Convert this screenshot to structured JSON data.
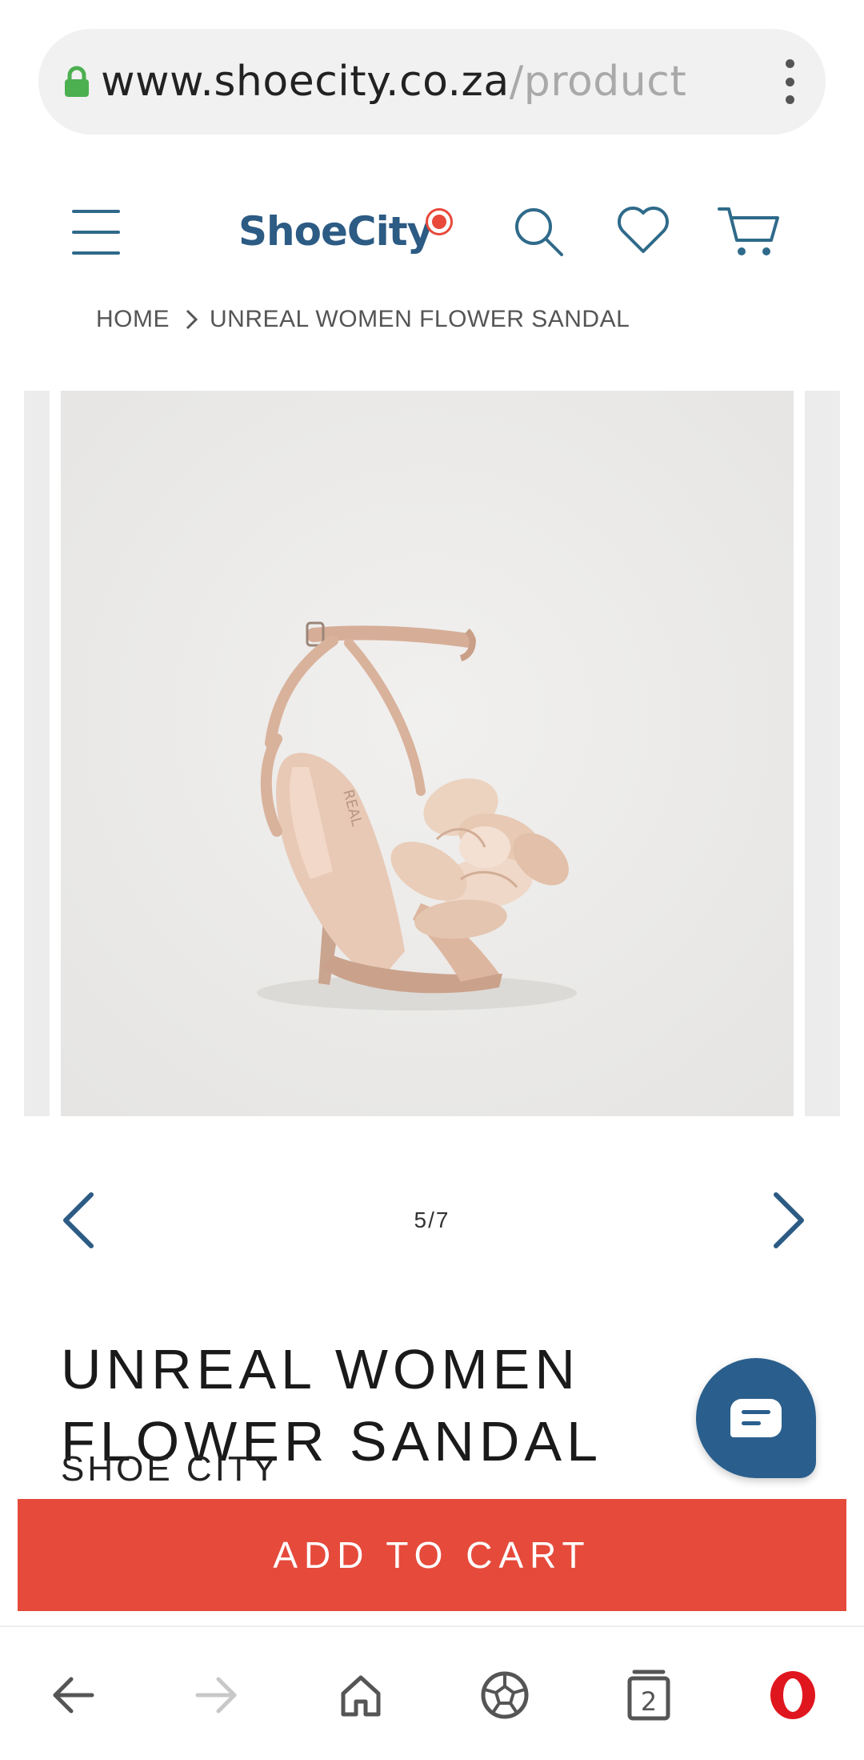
{
  "browser": {
    "url_domain": "www.shoecity.co.za",
    "url_path": "/product",
    "tab_count": "2"
  },
  "header": {
    "logo_text": "ShoeCity"
  },
  "breadcrumb": {
    "home": "HOME",
    "current": "UNREAL WOMEN FLOWER SANDAL"
  },
  "gallery": {
    "counter": "5/7",
    "current": 5,
    "total": 7,
    "sole_imprint": "REAL"
  },
  "product": {
    "title": "UNREAL WOMEN FLOWER SANDAL",
    "brand": "SHOE CITY"
  },
  "actions": {
    "add_to_cart": "ADD TO CART"
  },
  "colors": {
    "brand_blue": "#2c5b84",
    "accent_red": "#e64a3b",
    "chat_blue": "#2a5f8d"
  }
}
